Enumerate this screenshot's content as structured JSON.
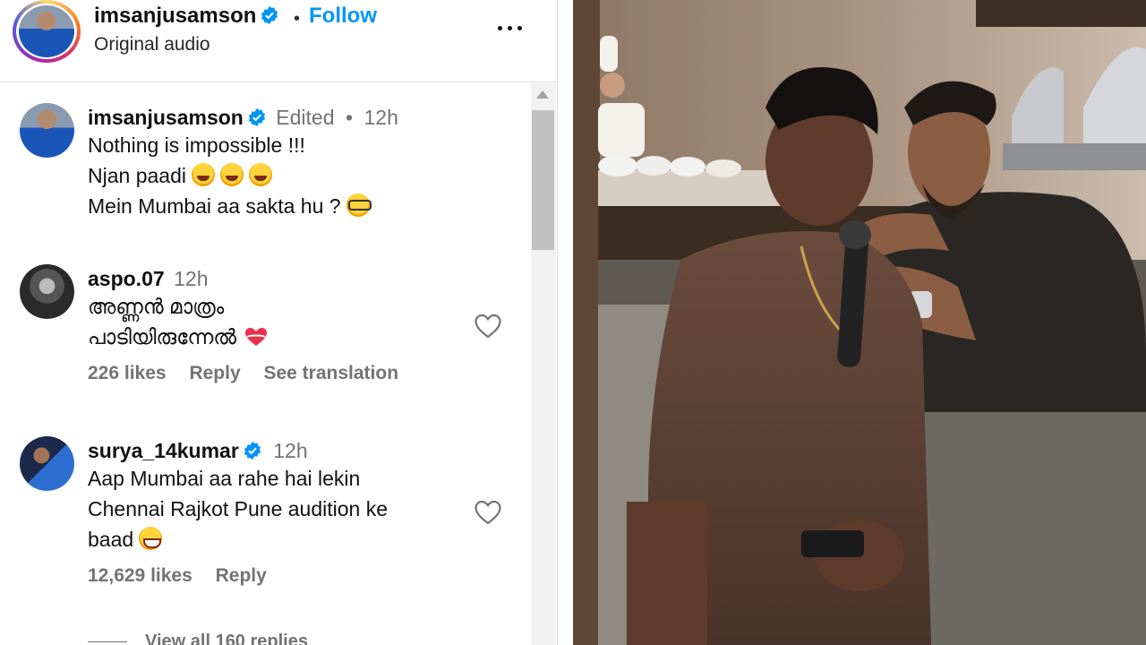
{
  "header": {
    "username": "imsanjusamson",
    "follow_label": "Follow",
    "subtitle": "Original audio"
  },
  "comments": [
    {
      "username": "imsanjusamson",
      "edited": "Edited",
      "time": "12h",
      "lines": [
        "Nothing is impossible !!!",
        "Njan paadi",
        "Mein Mumbai aa sakta hu ?"
      ]
    },
    {
      "username": "aspo.07",
      "time": "12h",
      "lines": [
        "അണ്ണൻ മാത്രം",
        "പാടിയിരുന്നേൽ"
      ],
      "likes": "226 likes",
      "reply": "Reply",
      "translate": "See translation"
    },
    {
      "username": "surya_14kumar",
      "time": "12h",
      "lines": [
        "Aap Mumbai aa rahe hai lekin",
        "Chennai Rajkot Pune audition ke",
        "baad"
      ],
      "likes": "12,629 likes",
      "reply": "Reply"
    }
  ],
  "view_replies": "View all 160 replies",
  "colors": {
    "accent": "#0095f6",
    "verified": "#0095f6",
    "muted": "#737373"
  },
  "icons": [
    "verified-badge-icon",
    "more-options-icon",
    "heart-icon",
    "scroll-up-icon"
  ]
}
